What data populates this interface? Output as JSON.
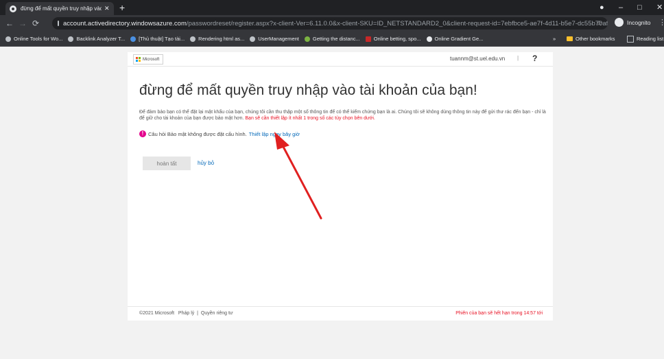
{
  "browser": {
    "tab_title": "đừng để mất quyền truy nhập vào",
    "tab_close": "✕",
    "new_tab": "+",
    "url_host": "account.activedirectory.windowsazure.com",
    "url_path": "/passwordreset/register.aspx?x-client-Ver=6.11.0.0&x-client-SKU=ID_NETSTANDARD2_0&client-request-id=7ebfbce5-ae7f-4d11-b5e7-dc55b70affbd&iss...",
    "profile_label": "Incognito",
    "bookmarks": [
      "Online Tools for Wo...",
      "Backlink Analyzer T...",
      "[Thủ thuật] Tạo tài...",
      "Rendering html as...",
      "UserManagement",
      "Getting the distanc...",
      "Online betting, spo...",
      "Online Gradient Ge..."
    ],
    "bookmarks_overflow": "»",
    "other_bookmarks": "Other bookmarks",
    "reading_list": "Reading list"
  },
  "header": {
    "logo_text": "Microsoft",
    "user_email": "tuannm@st.uel.edu.vn",
    "separator": "|",
    "help": "?"
  },
  "main": {
    "title": "đừng để mất quyền truy nhập vào tài khoản của bạn!",
    "description": "Để đảm bảo bạn có thể đặt lại mật khẩu của bạn, chúng tôi cần thu thập một số thông tin để có thể kiểm chứng bạn là ai. Chúng tôi sẽ không dùng thông tin này để gửi thư rác đến bạn - chỉ là để giữ cho tài khoản của bạn được bảo mật hơn.",
    "description_required": "Bạn sẽ cần thiết lập ít nhất 1 trong số các tùy chọn bên dưới.",
    "alert_icon": "!",
    "security_question_msg": "Câu hỏi Bảo mật không được đặt cấu hình.",
    "setup_link": "Thiết lập ngay bây giờ",
    "finish_button": "hoàn tất",
    "cancel_link": "hủy bỏ"
  },
  "footer": {
    "copyright": "©2021 Microsoft",
    "legal": "Pháp lý",
    "divider": "|",
    "privacy": "Quyền riêng tư",
    "session_notice": "Phiên của bạn sẽ hết hạn trong 14:57 tới"
  },
  "colors": {
    "alert": "#e3008c",
    "link": "#0067b8",
    "warning": "#e81123",
    "annotation_arrow": "#e02020"
  }
}
